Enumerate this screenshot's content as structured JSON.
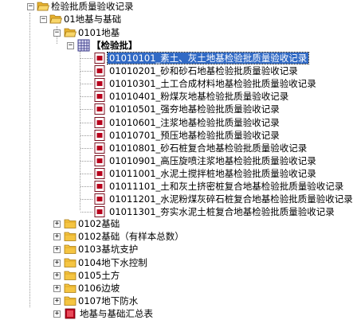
{
  "tree": {
    "root": {
      "label": "检验批质量验收记录"
    },
    "subgroup": {
      "label": "01地基与基础"
    },
    "section": {
      "label": "0101地基"
    },
    "batch_folder": {
      "label": "【检验批】"
    },
    "records": [
      "01010101_素土、灰土地基检验批质量验收记录",
      "01010201_砂和砂石地基检验批质量验收记录",
      "01010301_土工合成材料地基检验批质量验收记录",
      "01010401_粉煤灰地基检验批质量验收记录",
      "01010501_强夯地基检验批质量验收记录",
      "01010601_注浆地基检验批质量验收记录",
      "01010701_预压地基检验批质量验收记录",
      "01010801_砂石桩复合地基检验批质量验收记录",
      "01010901_高压旋喷注浆地基检验批质量验收记录",
      "01011001_水泥土搅拌桩地基检验批质量验收记录",
      "01011101_土和灰土挤密桩复合地基检验批质量验收记录",
      "01011201_水泥粉煤灰碎石桩复合地基检验批质量验收记录",
      "01011301_夯实水泥土桩复合地基检验批质量验收记录"
    ],
    "collapsed_sections": [
      "0102基础",
      "0102基础（有样本总数）",
      "0103基坑支护",
      "0104地下水控制",
      "0105土方",
      "0106边坡",
      "0107地下防水"
    ],
    "summary": {
      "label": "地基与基础汇总表"
    },
    "selected_index": 0,
    "colors": {
      "selection": "#316ac5",
      "folder": "#f5c542",
      "doc_icon": "#b8001c"
    }
  }
}
